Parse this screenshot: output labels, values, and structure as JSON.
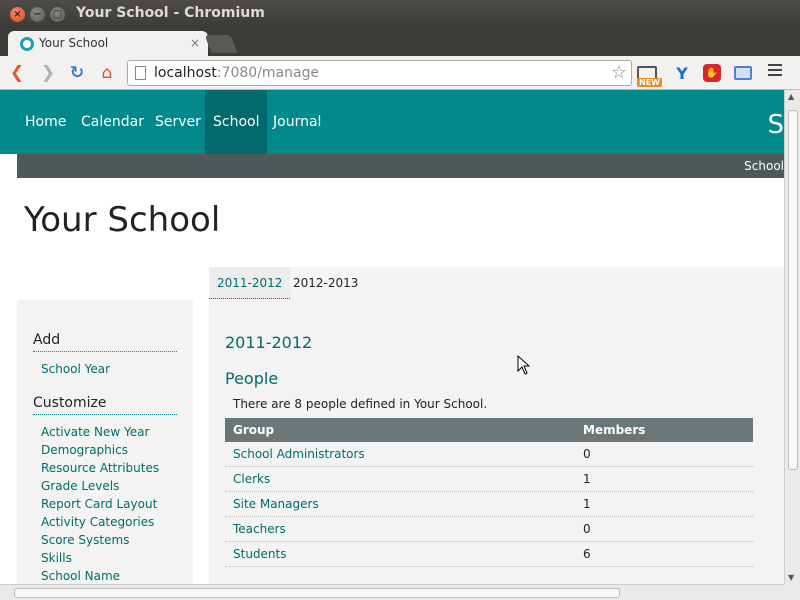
{
  "window": {
    "title": "Your School - Chromium"
  },
  "tab": {
    "title": "Your School"
  },
  "omnibox": {
    "host": "localhost",
    "rest": ":7080/manage"
  },
  "extensions": {
    "new_badge": "NEW"
  },
  "site": {
    "nav": [
      "Home",
      "Calendar",
      "Server",
      "School",
      "Journal"
    ],
    "active_nav": "School",
    "brand_partial": "S",
    "subbar_text": "School"
  },
  "page": {
    "title": "Your School"
  },
  "sidebar": {
    "add_heading": "Add",
    "add_items": [
      "School Year"
    ],
    "customize_heading": "Customize",
    "customize_items": [
      "Activate New Year",
      "Demographics",
      "Resource Attributes",
      "Grade Levels",
      "Report Card Layout",
      "Activity Categories",
      "Score Systems",
      "Skills",
      "School Name"
    ]
  },
  "year_tabs": [
    "2011-2012",
    "2012-2013"
  ],
  "content": {
    "year_heading": "2011-2012",
    "people_heading": "People",
    "people_desc": "There are 8 people defined in Your School.",
    "table": {
      "headers": [
        "Group",
        "Members"
      ],
      "rows": [
        [
          "School Administrators",
          "0"
        ],
        [
          "Clerks",
          "1"
        ],
        [
          "Site Managers",
          "1"
        ],
        [
          "Teachers",
          "0"
        ],
        [
          "Students",
          "6"
        ]
      ]
    }
  }
}
